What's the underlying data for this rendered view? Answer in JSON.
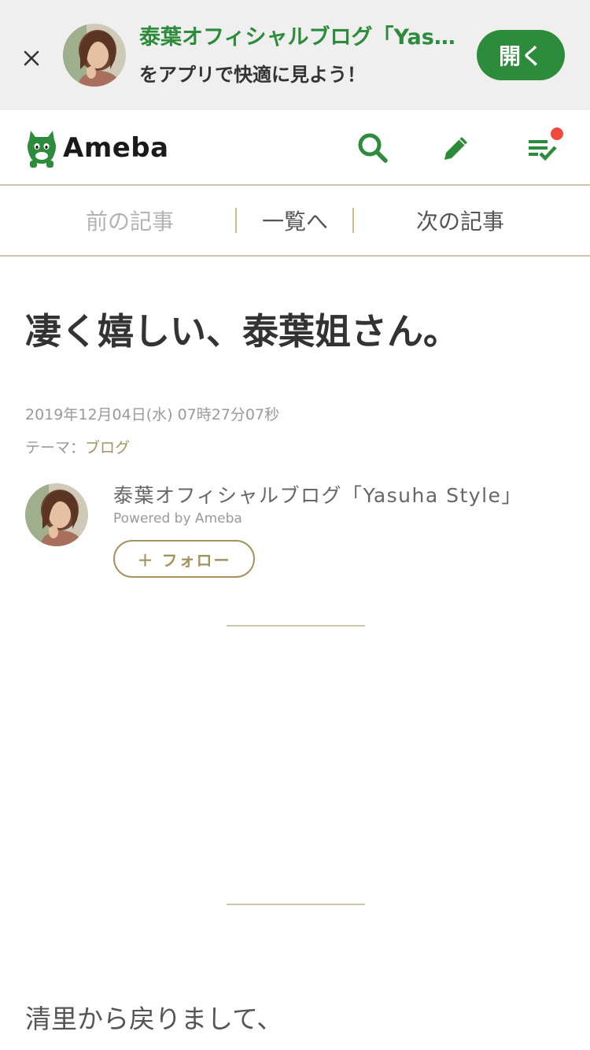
{
  "app_banner": {
    "blog_title": "泰葉オフィシャルブログ「Yasuha Style」",
    "subtitle": "をアプリで快適に見よう！",
    "open_label": "開く",
    "close_icon": "close-icon"
  },
  "header": {
    "logo_text": "Ameba",
    "icons": [
      "search-icon",
      "pencil-icon",
      "reading-list-icon"
    ],
    "has_notification": true
  },
  "pager": {
    "prev_label": "前の記事",
    "list_label": "一覧へ",
    "next_label": "次の記事"
  },
  "article": {
    "title": "凄く嬉しい、泰葉姐さん。",
    "date": "2019年12月04日(水) 07時27分07秒",
    "theme_prefix": "テーマ：",
    "theme": "ブログ",
    "body_first_line": "清里から戻りまして、"
  },
  "author": {
    "name": "泰葉オフィシャルブログ「Yasuha Style」",
    "powered_by": "Powered by Ameba",
    "follow_label": "＋ フォロー"
  },
  "colors": {
    "brand_green": "#2d8c3c",
    "accent_gold": "#a4935f",
    "notification": "#ee4b3b",
    "banner_bg": "#efefef"
  }
}
